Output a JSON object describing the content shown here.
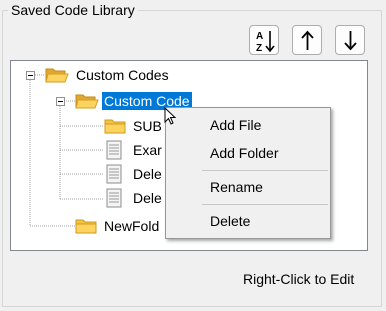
{
  "group": {
    "title": "Saved Code Library"
  },
  "toolbar": {
    "sort": {
      "icon": "sort-az-icon",
      "top": "A",
      "bottom": "Z"
    },
    "move_up": {
      "icon": "arrow-up-icon"
    },
    "move_down": {
      "icon": "arrow-down-icon"
    }
  },
  "tree": {
    "nodes": [
      {
        "label": "Custom Codes",
        "type": "folder",
        "expanded": true
      },
      {
        "label": "Custom Code",
        "type": "folder",
        "expanded": true,
        "selected": true
      },
      {
        "label": "SUB",
        "type": "folder"
      },
      {
        "label": "Exar",
        "type": "file"
      },
      {
        "label": "Dele",
        "type": "file"
      },
      {
        "label": "Dele",
        "type": "file"
      },
      {
        "label": "NewFold",
        "type": "folder"
      }
    ]
  },
  "context_menu": {
    "items": [
      "Add File",
      "Add Folder",
      "Rename",
      "Delete"
    ]
  },
  "footer": {
    "hint": "Right-Click to Edit"
  },
  "colors": {
    "selection": "#0078d7",
    "folder": "#f5c342",
    "background": "#f0f0f0"
  }
}
